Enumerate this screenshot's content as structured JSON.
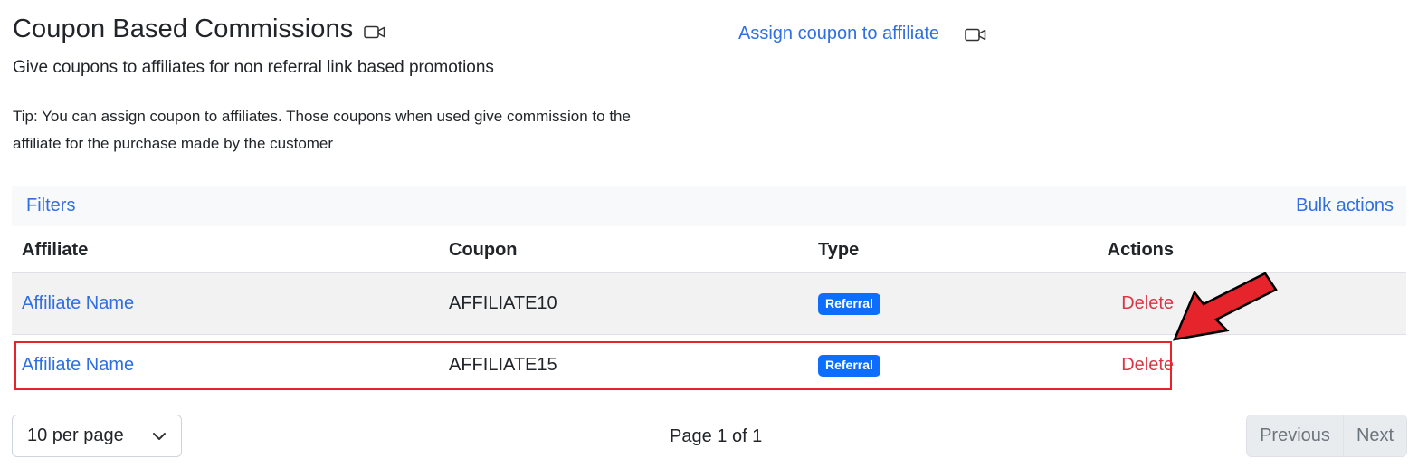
{
  "header": {
    "title": "Coupon Based Commissions",
    "subtitle": "Give coupons to affiliates for non referral link based promotions",
    "tip": "Tip: You can assign coupon to affiliates. Those coupons when used give commission to the affiliate for the purchase made by the customer",
    "assign_link": "Assign coupon to affiliate",
    "video_icon": "video-camera-icon"
  },
  "toolbar": {
    "filters_label": "Filters",
    "bulk_actions_label": "Bulk actions"
  },
  "table": {
    "columns": [
      "Affiliate",
      "Coupon",
      "Type",
      "Actions"
    ],
    "rows": [
      {
        "affiliate": "Affiliate Name",
        "coupon": "AFFILIATE10",
        "type": "Referral",
        "action": "Delete"
      },
      {
        "affiliate": "Affiliate Name",
        "coupon": "AFFILIATE15",
        "type": "Referral",
        "action": "Delete"
      }
    ]
  },
  "pagination": {
    "per_page": "10 per page",
    "page_info": "Page 1 of 1",
    "previous_label": "Previous",
    "next_label": "Next"
  },
  "colors": {
    "link": "#2f6fe0",
    "danger": "#dc3545",
    "badge": "#0d6efd",
    "annotation": "#e5242b"
  }
}
